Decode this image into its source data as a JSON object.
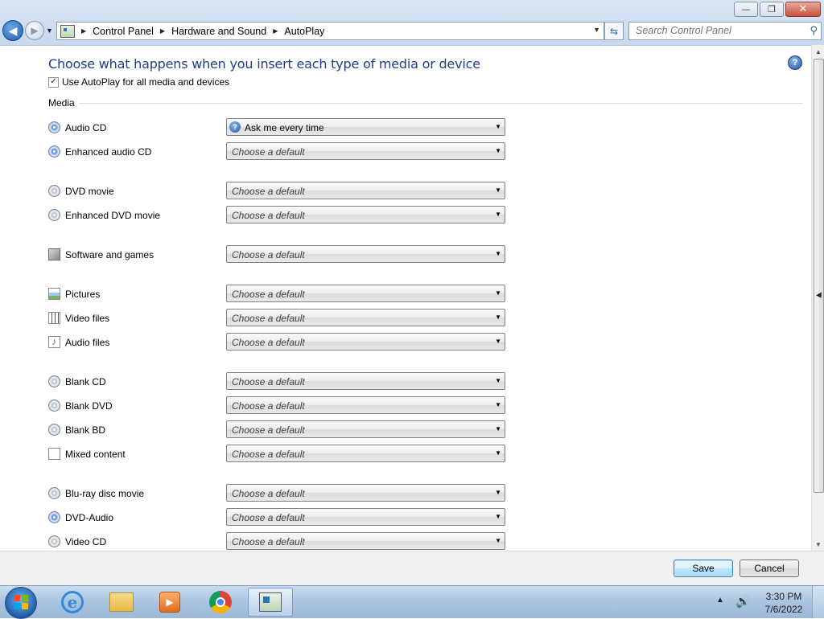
{
  "window": {
    "caption": {
      "minimize": "—",
      "restore": "❐",
      "close": "✕"
    }
  },
  "nav": {
    "breadcrumb": [
      "Control Panel",
      "Hardware and Sound",
      "AutoPlay"
    ],
    "search_placeholder": "Search Control Panel"
  },
  "header": {
    "title": "Choose what happens when you insert each type of media or device",
    "help": "?",
    "autoplay_checkbox_label": "Use AutoPlay for all media and devices",
    "autoplay_checked": true
  },
  "section": {
    "label": "Media"
  },
  "media": [
    {
      "label": "Audio CD",
      "icon": "audio-cd-icon",
      "value": "Ask me every time",
      "set": true
    },
    {
      "label": "Enhanced audio CD",
      "icon": "enhanced-audio-cd-icon",
      "value": "Choose a default",
      "set": false
    },
    {
      "label": "DVD movie",
      "icon": "dvd-movie-icon",
      "value": "Choose a default",
      "set": false
    },
    {
      "label": "Enhanced DVD movie",
      "icon": "enhanced-dvd-movie-icon",
      "value": "Choose a default",
      "set": false
    },
    {
      "label": "Software and games",
      "icon": "software-games-icon",
      "value": "Choose a default",
      "set": false
    },
    {
      "label": "Pictures",
      "icon": "pictures-icon",
      "value": "Choose a default",
      "set": false
    },
    {
      "label": "Video files",
      "icon": "video-files-icon",
      "value": "Choose a default",
      "set": false
    },
    {
      "label": "Audio files",
      "icon": "audio-files-icon",
      "value": "Choose a default",
      "set": false
    },
    {
      "label": "Blank CD",
      "icon": "blank-cd-icon",
      "value": "Choose a default",
      "set": false
    },
    {
      "label": "Blank DVD",
      "icon": "blank-dvd-icon",
      "value": "Choose a default",
      "set": false
    },
    {
      "label": "Blank BD",
      "icon": "blank-bd-icon",
      "value": "Choose a default",
      "set": false
    },
    {
      "label": "Mixed content",
      "icon": "mixed-content-icon",
      "value": "Choose a default",
      "set": false
    },
    {
      "label": "Blu-ray disc movie",
      "icon": "bluray-movie-icon",
      "value": "Choose a default",
      "set": false
    },
    {
      "label": "DVD-Audio",
      "icon": "dvd-audio-icon",
      "value": "Choose a default",
      "set": false
    },
    {
      "label": "Video CD",
      "icon": "video-cd-icon",
      "value": "Choose a default",
      "set": false
    }
  ],
  "buttons": {
    "save": "Save",
    "cancel": "Cancel"
  },
  "taskbar": {
    "apps": [
      "internet-explorer-icon",
      "file-explorer-icon",
      "media-player-icon",
      "chrome-icon",
      "control-panel-icon"
    ],
    "time": "3:30 PM",
    "date": "7/6/2022"
  },
  "colors": {
    "title_blue": "#1e3d8a",
    "accent": "#2456a3"
  }
}
